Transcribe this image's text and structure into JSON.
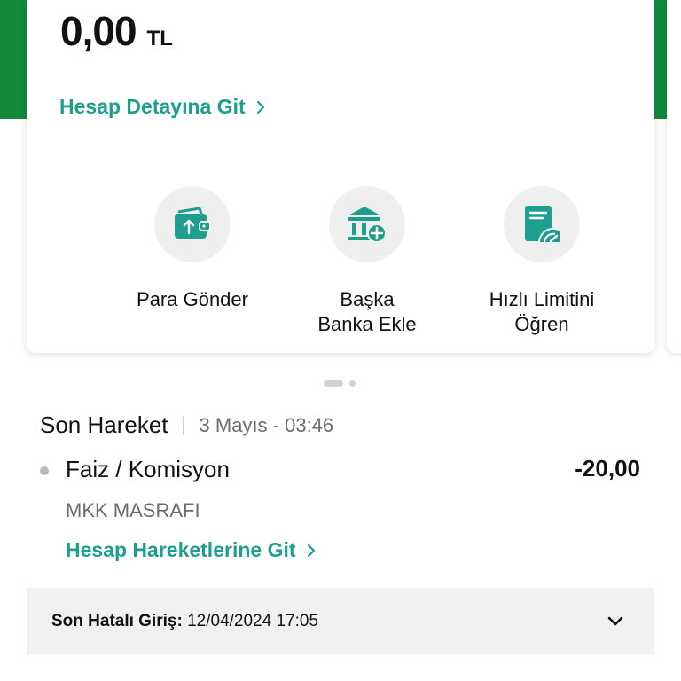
{
  "colors": {
    "brand_green": "#118a3a",
    "accent_teal": "#1e9e8e"
  },
  "account": {
    "balance": "0,00",
    "currency": "TL",
    "detail_link": "Hesap Detayına Git"
  },
  "actions": [
    {
      "label": "Para Gönder",
      "icon": "wallet-send-icon"
    },
    {
      "label": "Başka Banka Ekle",
      "line1": "Başka",
      "line2": "Banka Ekle",
      "icon": "bank-add-icon"
    },
    {
      "label": "Hızlı Limitini Öğren",
      "line1": "Hızlı Limitini",
      "line2": "Öğren",
      "icon": "limit-gauge-icon"
    }
  ],
  "last_transaction": {
    "title": "Son Hareket",
    "date": "3 Mayıs - 03:46",
    "name": "Faiz / Komisyon",
    "amount": "-20,00",
    "description": "MKK MASRAFI",
    "link": "Hesap Hareketlerine Git"
  },
  "last_failed_login": {
    "label": "Son Hatalı Giriş:",
    "value": "12/04/2024 17:05"
  }
}
